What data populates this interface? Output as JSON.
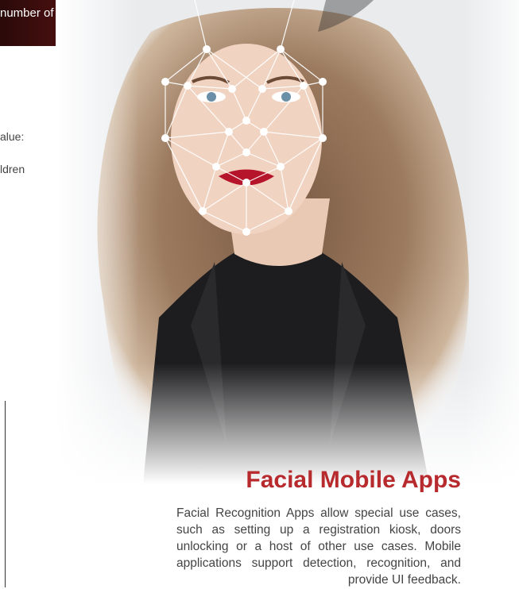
{
  "banner": {
    "text": "number of false alarms"
  },
  "left_column": {
    "line1": "alue:",
    "line2": "ldren"
  },
  "photo": {
    "alt_icon": "face-recognition-mesh-icon"
  },
  "section": {
    "title": "Facial Mobile Apps",
    "body": "Facial Recognition Apps allow special use cases, such as setting up a registration kiosk, doors unlocking or a host of other use cases. Mobile applications support detection, recognition, and provide UI feedback."
  },
  "colors": {
    "accent": "#b72a2d",
    "banner": "#6a1414"
  }
}
